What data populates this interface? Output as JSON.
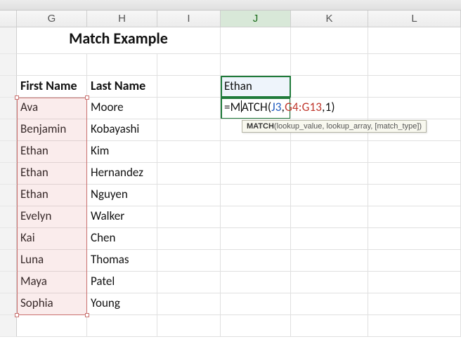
{
  "columns": [
    "G",
    "H",
    "I",
    "J",
    "K",
    "L"
  ],
  "col_widths": {
    "G": 100,
    "H": 100,
    "I": 90,
    "J": 100,
    "K": 110,
    "L": 132
  },
  "active_column": "J",
  "title": "Match Example",
  "headers": {
    "first": "First Name",
    "last": "Last Name"
  },
  "lookup_cell": "Ethan",
  "formula": {
    "raw": "=MATCH(J3,G4:G13,1)",
    "eq": "=",
    "fn_head": "M",
    "fn_tail": "ATCH",
    "open": "(",
    "ref1": "J3",
    "c1": ",",
    "ref2": "G4:G13",
    "c2": ",",
    "num": "1",
    "close": ")"
  },
  "tooltip": {
    "fn": "MATCH",
    "sig": "(lookup_value, lookup_array, [match_type])"
  },
  "data_rows": [
    {
      "first": "Ava",
      "last": "Moore"
    },
    {
      "first": "Benjamin",
      "last": "Kobayashi"
    },
    {
      "first": "Ethan",
      "last": "Kim"
    },
    {
      "first": "Ethan",
      "last": "Hernandez"
    },
    {
      "first": "Ethan",
      "last": "Nguyen"
    },
    {
      "first": "Evelyn",
      "last": "Walker"
    },
    {
      "first": "Kai",
      "last": "Chen"
    },
    {
      "first": "Luna",
      "last": "Thomas"
    },
    {
      "first": "Maya",
      "last": "Patel"
    },
    {
      "first": "Sophia",
      "last": "Young"
    }
  ],
  "chart_data": {
    "type": "table",
    "title": "Match Example",
    "columns": [
      "First Name",
      "Last Name"
    ],
    "rows": [
      [
        "Ava",
        "Moore"
      ],
      [
        "Benjamin",
        "Kobayashi"
      ],
      [
        "Ethan",
        "Kim"
      ],
      [
        "Ethan",
        "Hernandez"
      ],
      [
        "Ethan",
        "Nguyen"
      ],
      [
        "Evelyn",
        "Walker"
      ],
      [
        "Kai",
        "Chen"
      ],
      [
        "Luna",
        "Thomas"
      ],
      [
        "Maya",
        "Patel"
      ],
      [
        "Sophia",
        "Young"
      ]
    ],
    "lookup_value_cell": "J3",
    "lookup_value": "Ethan",
    "formula_cell": "J4",
    "formula": "=MATCH(J3,G4:G13,1)"
  }
}
